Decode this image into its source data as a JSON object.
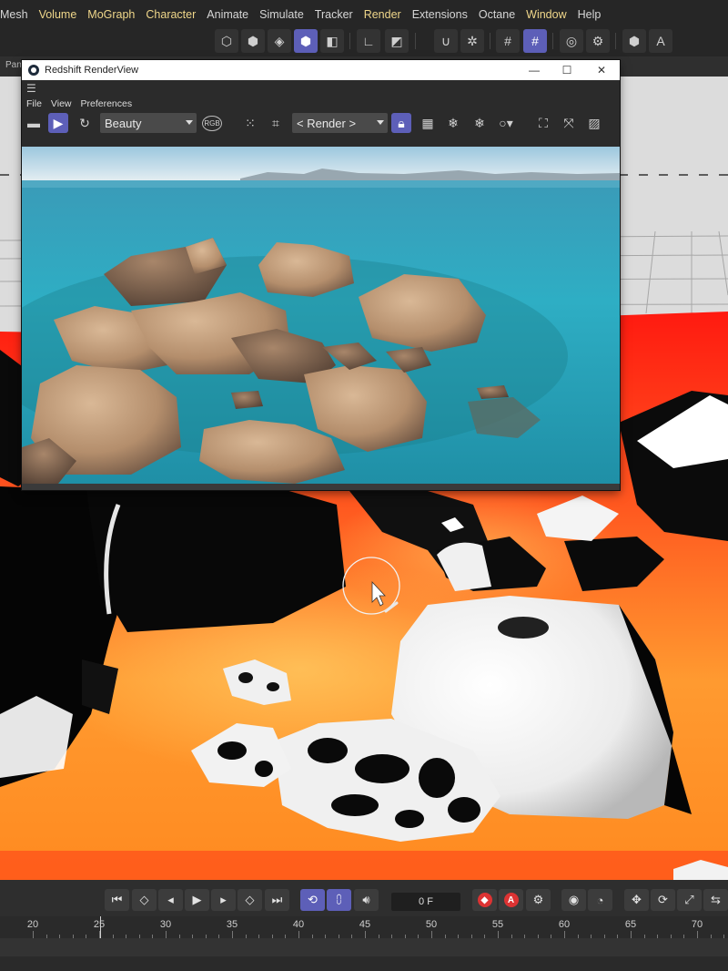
{
  "menubar": {
    "items": [
      {
        "label": "Mesh",
        "hl": false
      },
      {
        "label": "Volume",
        "hl": true
      },
      {
        "label": "MoGraph",
        "hl": true
      },
      {
        "label": "Character",
        "hl": true
      },
      {
        "label": "Animate",
        "hl": false
      },
      {
        "label": "Simulate",
        "hl": false
      },
      {
        "label": "Tracker",
        "hl": false
      },
      {
        "label": "Render",
        "hl": true
      },
      {
        "label": "Extensions",
        "hl": false
      },
      {
        "label": "Octane",
        "hl": false
      },
      {
        "label": "Window",
        "hl": true
      },
      {
        "label": "Help",
        "hl": false
      }
    ]
  },
  "subbar": {
    "tab": "Pan"
  },
  "renderview": {
    "title": "Redshift RenderView",
    "menu": [
      "File",
      "View",
      "Preferences"
    ],
    "aov_select": "Beauty",
    "camera_select": "< Render >",
    "rgb_label": "RGB"
  },
  "timeline": {
    "frame_field": "0 F",
    "ticks": [
      "20",
      "25",
      "30",
      "35",
      "40",
      "45",
      "50",
      "55",
      "60",
      "65",
      "70"
    ]
  },
  "colors": {
    "accent": "#5d5fb8",
    "heat_red": "#ff1a10",
    "heat_orange": "#ffa030"
  }
}
